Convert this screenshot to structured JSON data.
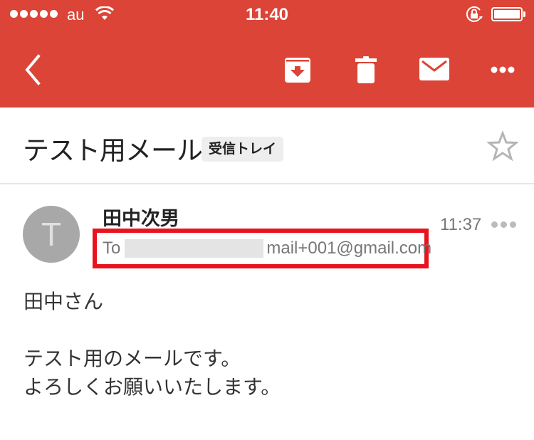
{
  "status_bar": {
    "signal_dots": 5,
    "carrier": "au",
    "time": "11:40",
    "battery_level": 1.0
  },
  "toolbar": {
    "back_icon": "chevron-left-icon",
    "archive_icon": "archive-icon",
    "delete_icon": "trash-icon",
    "mark_unread_icon": "mail-icon",
    "more_icon": "more-horizontal-icon"
  },
  "message": {
    "subject": "テスト用メール",
    "label": "受信トレイ",
    "starred": false,
    "sender": {
      "avatar_letter": "T",
      "name": "田中次男"
    },
    "recipient": {
      "prefix": "To",
      "address_visible": "mail+001@gmail.com"
    },
    "time": "11:37",
    "body": {
      "greeting": "田中さん",
      "line1": "テスト用のメールです。",
      "line2": "よろしくお願いいたします。"
    }
  },
  "colors": {
    "header_red": "#db4437",
    "highlight_box": "#e8131e",
    "avatar_gray": "#a8a8a8"
  }
}
